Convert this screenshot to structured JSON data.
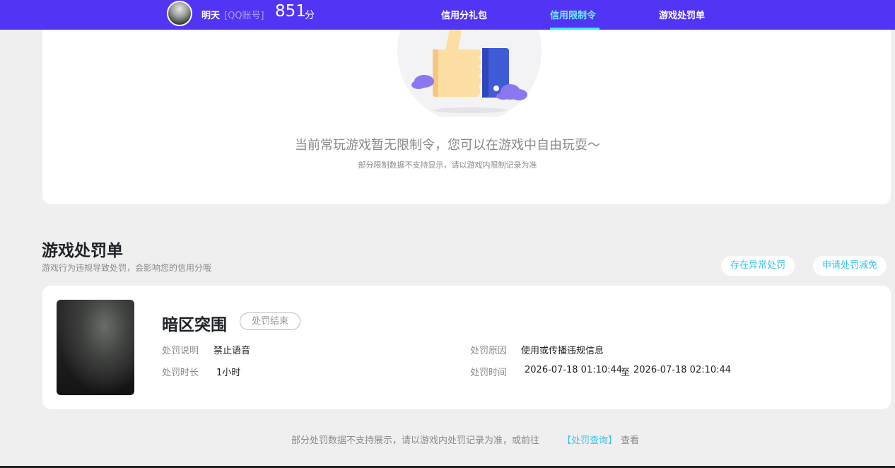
{
  "header": {
    "username": "明天",
    "account_type": "[QQ账号]",
    "score": "851",
    "score_unit": "分",
    "nav": [
      {
        "label": "信用分礼包",
        "active": false
      },
      {
        "label": "信用限制令",
        "active": true
      },
      {
        "label": "游戏处罚单",
        "active": false
      }
    ]
  },
  "restriction": {
    "empty_message": "当前常玩游戏暂无限制令，您可以在游戏中自由玩耍～",
    "note": "部分限制数据不支持显示，请以游戏内限制记录为准"
  },
  "penalty_section": {
    "title": "游戏处罚单",
    "subtitle": "游戏行为违规导致处罚，会影响您的信用分哦",
    "actions": [
      "存在异常处罚",
      "申请处罚减免"
    ],
    "items": [
      {
        "game": "暗区突围",
        "status": "处罚结束",
        "desc_label": "处罚说明",
        "desc": "禁止语音",
        "duration_label": "处罚时长",
        "duration": "1小时",
        "reason_label": "处罚原因",
        "reason": "使用或传播违规信息",
        "time_label": "处罚时间",
        "time_start": "2026-07-18 01:10:44",
        "time_sep": "至",
        "time_end": "2026-07-18 02:10:44"
      }
    ]
  },
  "footer": {
    "text": "部分处罚数据不支持展示，请以游戏内处罚记录为准，或前往",
    "link": "【处罚查询】",
    "tail": "查看"
  },
  "colors": {
    "header_bg": "#5234f5",
    "active_nav": "#6ff0ff",
    "accent": "#3ec4ea",
    "page_bg": "#efefef"
  }
}
